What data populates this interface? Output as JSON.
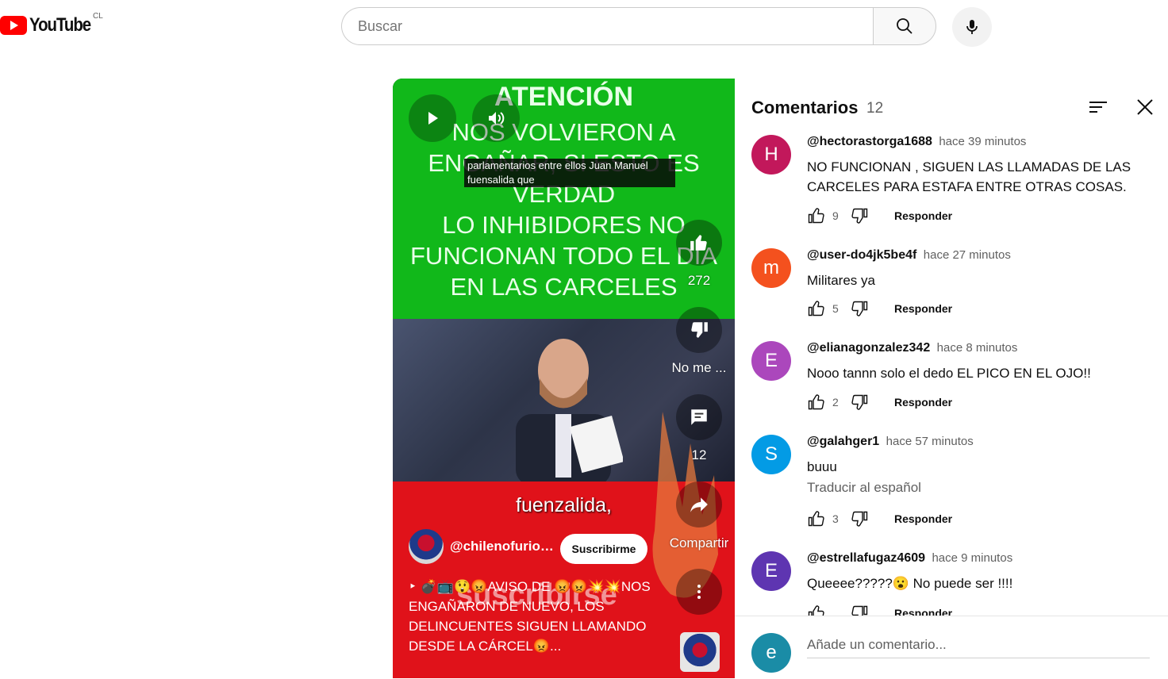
{
  "header": {
    "logo_text": "YouTube",
    "country": "CL",
    "search_placeholder": "Buscar"
  },
  "video": {
    "title_line": "ATENCIÓN",
    "body_lines": [
      "NOS VOLVIERON A",
      "ENGAÑAR, SI ESTO ES",
      "VERDAD",
      "LO INHIBIDORES NO",
      "FUNCIONAN TODO EL DÍA",
      "EN LAS CARCELES"
    ],
    "caption": "parlamentarios entre ellos Juan Manuel fuensalida que",
    "overlay_text": "fuenzalida,",
    "watermark": "suscribirse",
    "channel_name": "@chilenofurioso",
    "subscribe_label": "Suscribirme",
    "description": "‣ 💣📺😲😡AVISO DE 😡😡💥💥NOS ENGAÑARON DE NUEVO, LOS DELINCUENTES SIGUEN LLAMANDO DESDE LA CÁRCEL😡...",
    "actions": {
      "like_count": "272",
      "dislike_label": "No me ...",
      "comments_count": "12",
      "share_label": "Compartir"
    }
  },
  "comments_panel": {
    "title": "Comentarios",
    "count": "12",
    "reply_label": "Responder",
    "add_placeholder": "Añade un comentario...",
    "user_initial": "e",
    "user_color": "#1a8ca6",
    "comments": [
      {
        "initial": "H",
        "color": "#c2185b",
        "user": "@hectorastorga1688",
        "time": "hace 39 minutos",
        "text": "NO FUNCIONAN , SIGUEN LAS LLAMADAS DE LAS CARCELES PARA ESTAFA ENTRE OTRAS COSAS.",
        "likes": "9"
      },
      {
        "initial": "m",
        "color": "#f4511e",
        "user": "@user-do4jk5be4f",
        "time": "hace 27 minutos",
        "text": "Militares ya",
        "likes": "5"
      },
      {
        "initial": "E",
        "color": "#ab47bc",
        "user": "@elianagonzalez342",
        "time": "hace 8 minutos",
        "text": "Nooo tannn solo el dedo EL PICO EN EL OJO!!",
        "likes": "2"
      },
      {
        "initial": "S",
        "color": "#039be5",
        "user": "@galahger1",
        "time": "hace 57 minutos",
        "text": "buuu",
        "translate": "Traducir al español",
        "likes": "3"
      },
      {
        "initial": "E",
        "color": "#5e35b1",
        "user": "@estrellafugaz4609",
        "time": "hace 9 minutos",
        "text": "Queeee?????😮  No puede ser !!!!",
        "likes": ""
      }
    ]
  }
}
